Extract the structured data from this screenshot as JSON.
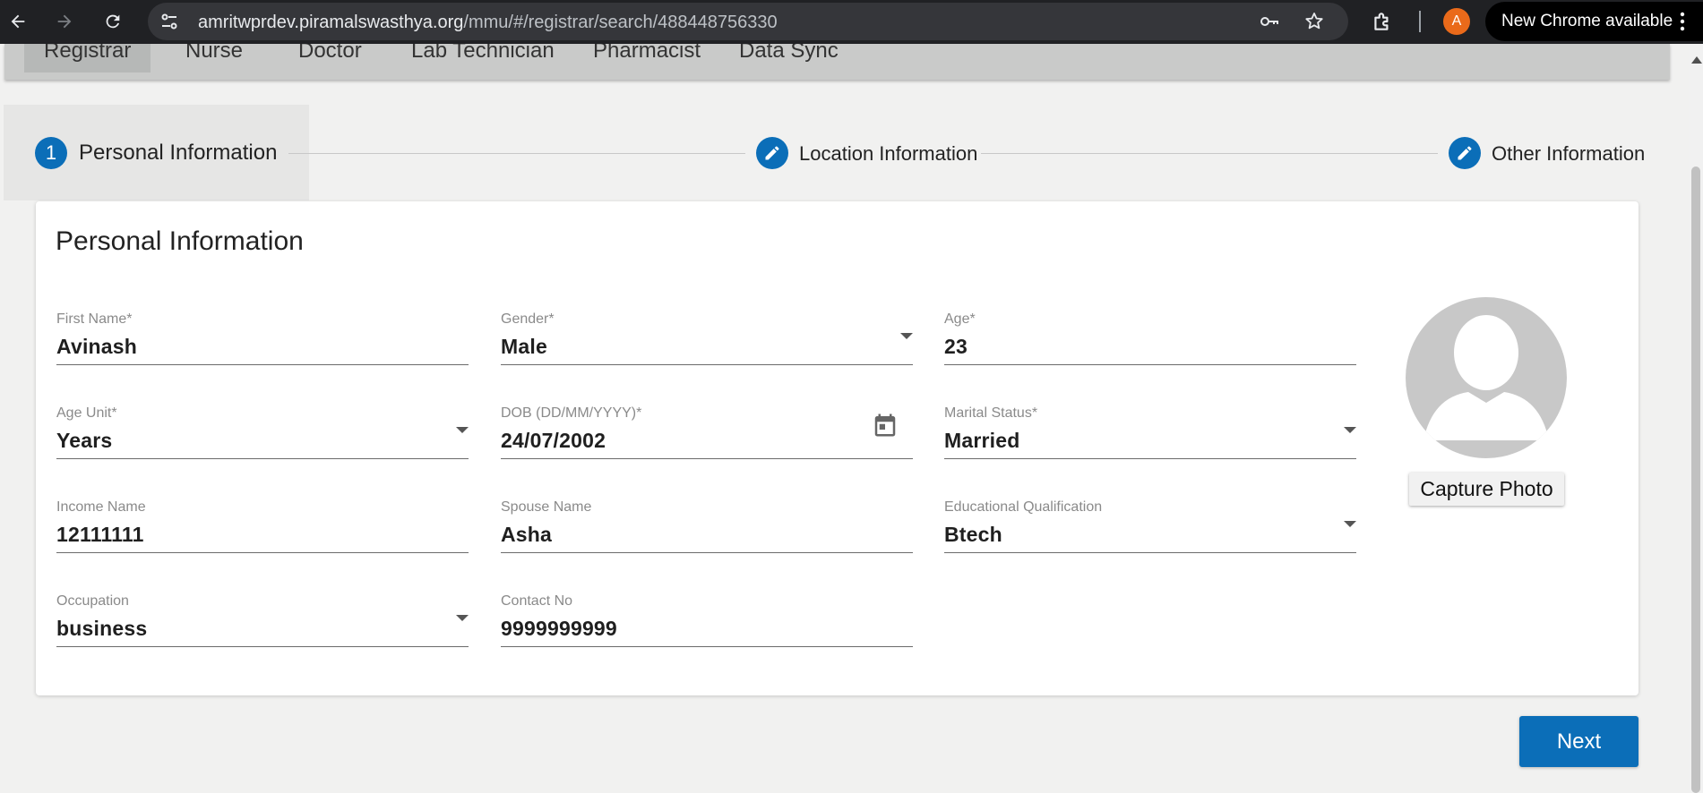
{
  "browser": {
    "url_host": "amritwprdev.piramalswasthya.org",
    "url_path": "/mmu/#/registrar/search/488448756330",
    "avatar_letter": "A",
    "update_label": "New Chrome available"
  },
  "app_tabs": [
    {
      "label": "Registrar",
      "active": true
    },
    {
      "label": "Nurse",
      "active": false
    },
    {
      "label": "Doctor",
      "active": false
    },
    {
      "label": "Lab Technician",
      "active": false
    },
    {
      "label": "Pharmacist",
      "active": false
    },
    {
      "label": "Data Sync",
      "active": false
    }
  ],
  "stepper": {
    "steps": [
      {
        "number": "1",
        "label": "Personal Information",
        "icon": "step-number",
        "active": true
      },
      {
        "number": "",
        "label": "Location Information",
        "icon": "pencil-icon",
        "active": false
      },
      {
        "number": "",
        "label": "Other Information",
        "icon": "pencil-icon",
        "active": false
      }
    ]
  },
  "form": {
    "title": "Personal Information",
    "fields": {
      "first_name": {
        "label": "First Name*",
        "value": "Avinash"
      },
      "gender": {
        "label": "Gender*",
        "value": "Male"
      },
      "age": {
        "label": "Age*",
        "value": "23"
      },
      "age_unit": {
        "label": "Age Unit*",
        "value": "Years"
      },
      "dob": {
        "label": "DOB (DD/MM/YYYY)*",
        "value": "24/07/2002"
      },
      "marital_status": {
        "label": "Marital Status*",
        "value": "Married"
      },
      "income_name": {
        "label": "Income Name",
        "value": "12111111"
      },
      "spouse_name": {
        "label": "Spouse Name",
        "value": "Asha"
      },
      "education": {
        "label": "Educational Qualification",
        "value": "Btech"
      },
      "occupation": {
        "label": "Occupation",
        "value": "business"
      },
      "contact_no": {
        "label": "Contact No",
        "value": "9999999999"
      }
    },
    "capture_photo_label": "Capture Photo"
  },
  "next_label": "Next",
  "colors": {
    "primary": "#0b6eb8",
    "chrome_bar": "#202124",
    "page_bg": "#f1f1f0"
  }
}
